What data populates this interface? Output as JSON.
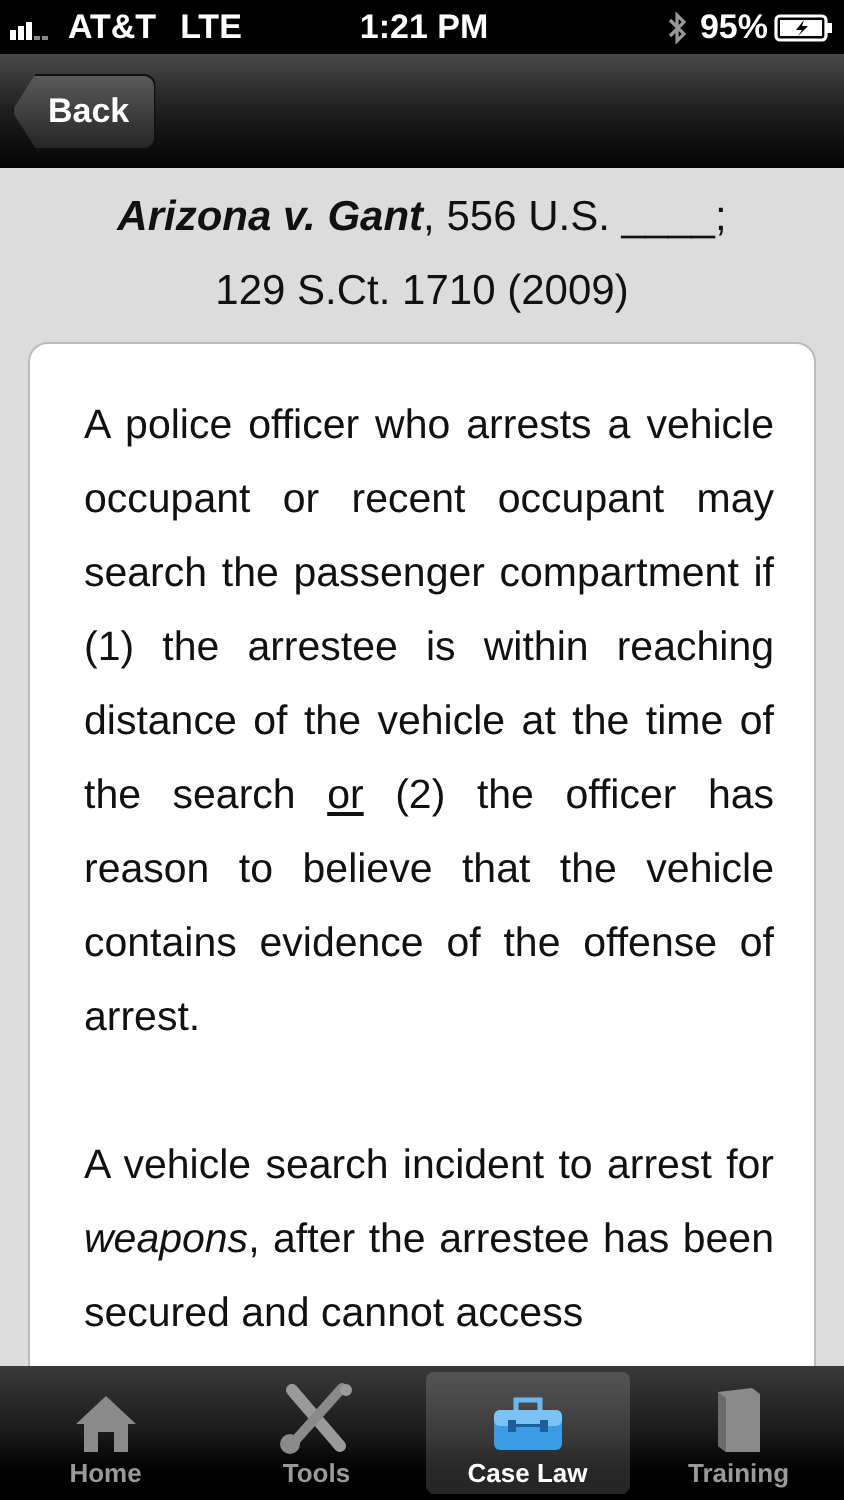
{
  "status_bar": {
    "carrier": "AT&T",
    "network": "LTE",
    "time": "1:21 PM",
    "battery": "95%"
  },
  "nav_bar": {
    "back_button": "Back"
  },
  "case_title": [
    "**Arizona v. Gant**, 556 U.S. ____;",
    "129 S.Ct. 1710 (2009)"
  ],
  "paragraphs": [
    {
      "runs": [
        {
          "text": "A police officer who arrests a vehicle occupant or recent occupant may search the passenger compartment if (1) the arrestee is within reaching distance of the vehicle at the time of the search ",
          "underline": false
        },
        {
          "text": "or",
          "underline": true
        },
        {
          "text": " (2) the officer has reason to believe that the vehicle contains evidence of the offense of arrest.",
          "underline": false
        }
      ]
    },
    {
      "runs": [
        {
          "text": "A vehicle search incident to arrest for *weapons*, after the arrestee has been secured and cannot access",
          "underline": false
        }
      ]
    }
  ],
  "tabs": [
    {
      "label": "Home",
      "selected": false
    },
    {
      "label": "Tools",
      "selected": false
    },
    {
      "label": "Case Law",
      "selected": true
    },
    {
      "label": "Training",
      "selected": false
    }
  ]
}
